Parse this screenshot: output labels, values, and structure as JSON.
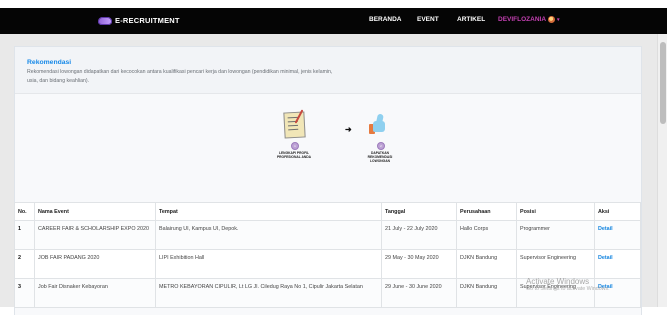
{
  "navbar": {
    "brand": "E-RECRUITMENT",
    "items": [
      "BERANDA",
      "EVENT",
      "ARTIKEL"
    ],
    "user": "DEVIFLOZANIA",
    "logo_color": "#8f62d6",
    "user_color": "#c340b1"
  },
  "section": {
    "title": "Rekomendasi",
    "description": "Rekomendasi lowongan didapatkan dari kecocokan antara kualifikasi pencari kerja dan lowongan (pendidikan minimal, jenis kelamin, usia, dan bidang keahlian).",
    "steps": [
      {
        "number": "1",
        "label": "LENGKAPI PROFIL PROFESIONAL ANDA",
        "icon": "document-edit-icon"
      },
      {
        "number": "2",
        "label": "DAPATKAN REKOMENDASI LOWONGAN",
        "icon": "thumb-up-icon"
      }
    ]
  },
  "table": {
    "headers": [
      "No.",
      "Nama Event",
      "Tempat",
      "Tanggal",
      "Perusahaan",
      "Posisi",
      "Aksi"
    ],
    "rows": [
      [
        "1",
        "CAREER FAIR & SCHOLARSHIP EXPO 2020",
        "Balairung UI, Kampus UI, Depok.",
        "21 July - 22 July 2020",
        "Hallo Corps",
        "Programmer",
        "Detail"
      ],
      [
        "2",
        "JOB FAIR PADANG 2020",
        "LIPI Exhibition Hall",
        "29 May - 30 May 2020",
        "DJKN Bandung",
        "Supervisor Engineering",
        "Detail"
      ],
      [
        "3",
        "Job Fair Disnaker Kebayoran",
        "METRO KEBAYORAN CIPULIR, Lt LG Jl. Ciledug Raya No 1, Cipulir Jakarta Selatan",
        "29 June - 30 June 2020",
        "DJKN Bandung",
        "Supervisor Engineering",
        "Detail"
      ]
    ]
  },
  "overlay": {
    "activate_title": "Activate Windows",
    "activate_subtitle": "Go to Settings to activate Windows."
  }
}
